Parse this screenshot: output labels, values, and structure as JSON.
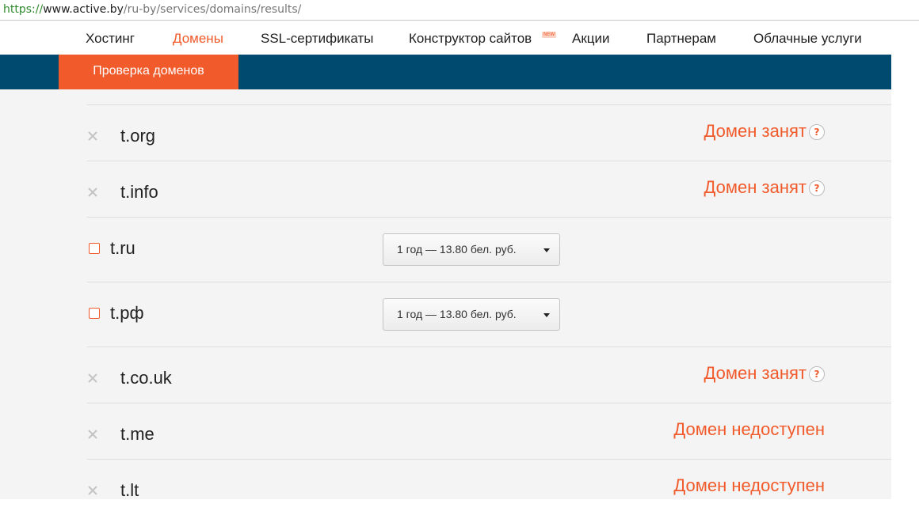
{
  "browser": {
    "url_scheme": "https://",
    "url_host": "www.active.by",
    "url_path": "/ru-by/services/domains/results/"
  },
  "nav": {
    "items": [
      {
        "label": "Хостинг",
        "active": false
      },
      {
        "label": "Домены",
        "active": true
      },
      {
        "label": "SSL-сертификаты",
        "active": false
      },
      {
        "label": "Конструктор сайтов",
        "active": false,
        "badge": "NEW"
      },
      {
        "label": "Акции",
        "active": false
      },
      {
        "label": "Партнерам",
        "active": false
      },
      {
        "label": "Облачные услуги",
        "active": false
      }
    ]
  },
  "subnav": {
    "tab": "Проверка доменов"
  },
  "results": [
    {
      "domain": "t.org",
      "kind": "taken",
      "status": "Домен занят",
      "help": "?"
    },
    {
      "domain": "t.info",
      "kind": "taken",
      "status": "Домен занят",
      "help": "?"
    },
    {
      "domain": "t.ru",
      "kind": "available",
      "price": "1 год — 13.80 бел. руб."
    },
    {
      "domain": "t.рф",
      "kind": "available",
      "price": "1 год — 13.80 бел. руб."
    },
    {
      "domain": "t.co.uk",
      "kind": "taken",
      "status": "Домен занят",
      "help": "?"
    },
    {
      "domain": "t.me",
      "kind": "unavailable",
      "status": "Домен недоступен"
    },
    {
      "domain": "t.lt",
      "kind": "unavailable",
      "status": "Домен недоступен"
    }
  ],
  "colors": {
    "accent": "#f15a2b",
    "subnav_bg": "#004a70",
    "page_bg": "#f4f4f4"
  }
}
